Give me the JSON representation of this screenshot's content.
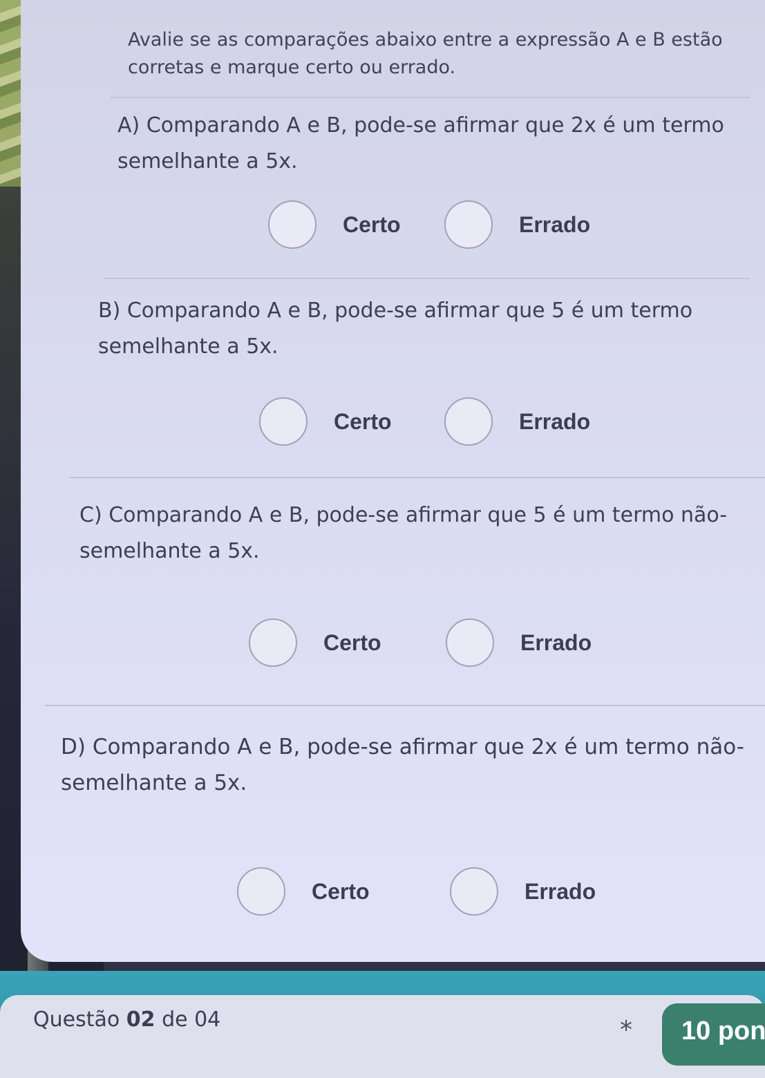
{
  "intro": "Avalie se as comparações abaixo entre a expressão A e B estão corretas e marque certo ou errado.",
  "questions": [
    {
      "text": "A) Comparando A e B, pode-se afirmar que 2x é um termo semelhante a 5x.",
      "option_certo": "Certo",
      "option_errado": "Errado"
    },
    {
      "text": "B) Comparando A e B, pode-se afirmar que 5 é um termo semelhante a 5x.",
      "option_certo": "Certo",
      "option_errado": "Errado"
    },
    {
      "text": "C) Comparando A e B, pode-se afirmar que 5 é um termo não-semelhante a 5x.",
      "option_certo": "Certo",
      "option_errado": "Errado"
    },
    {
      "text": "D) Comparando A e B, pode-se afirmar que 2x é um termo não-semelhante a 5x.",
      "option_certo": "Certo",
      "option_errado": "Errado"
    }
  ],
  "footer": {
    "question_prefix": "Questão",
    "question_number": "02",
    "question_of": "de 04",
    "required_marker": "*",
    "points": "10 pon"
  }
}
